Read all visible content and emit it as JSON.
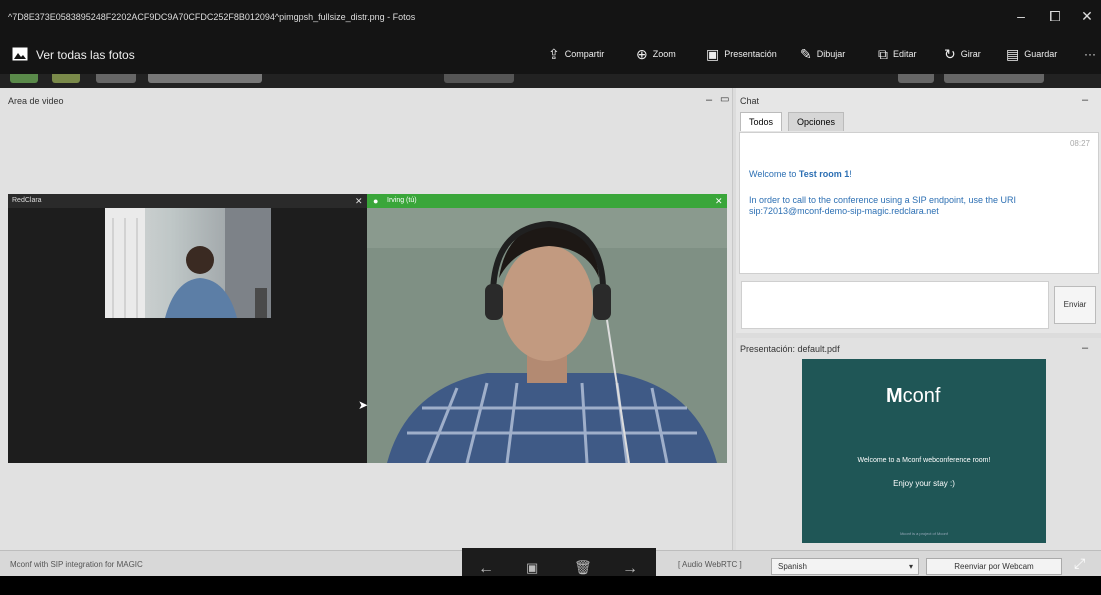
{
  "window": {
    "title": "^7D8E373E0583895248F2202ACF9DC9A70CFDC252F8B012094^pimgpsh_fullsize_distr.png - Fotos",
    "minimize": "‒",
    "maximize": "⧠",
    "close": "✕"
  },
  "toolbar": {
    "back_label": "Ver todas las fotos",
    "items": [
      {
        "label": "Compartir",
        "icon": "share-icon"
      },
      {
        "label": "Zoom",
        "icon": "zoom-icon"
      },
      {
        "label": "Presentación",
        "icon": "slideshow-icon"
      },
      {
        "label": "Dibujar",
        "icon": "draw-icon"
      },
      {
        "label": "Editar",
        "icon": "edit-icon"
      },
      {
        "label": "Girar",
        "icon": "rotate-icon"
      },
      {
        "label": "Guardar",
        "icon": "save-icon"
      }
    ],
    "more": "···"
  },
  "video": {
    "panel_title": "Area de video",
    "minimize": "–",
    "maximize": "▭",
    "feed1_name": "RedClara",
    "feed1_close": "✕",
    "feed2_name": "Irving (tú)",
    "feed2_close": "✕"
  },
  "chat": {
    "panel_title": "Chat",
    "minimize": "–",
    "tabs": [
      "Todos",
      "Opciones"
    ],
    "time": "08:27",
    "welcome_prefix": "Welcome to ",
    "room": "Test room 1",
    "welcome_suffix": "!",
    "sip_msg": "In order to call to the conference using a SIP endpoint, use the URI sip:72013@mconf-demo-sip-magic.redclara.net",
    "send_label": "Enviar"
  },
  "presentation": {
    "panel_title": "Presentación: default.pdf",
    "minimize": "–",
    "logo_m": "M",
    "logo_rest": "conf",
    "welcome": "Welcome to a Mconf webconference room!",
    "enjoy": "Enjoy your stay :)",
    "footer": "Mconf is a project of Mconf"
  },
  "status": {
    "left_text": "Mconf with SIP integration for MAGIC",
    "audio": "[ Audio WebRTC ]",
    "language": "Spanish",
    "webcam_btn": "Reenviar por Webcam"
  },
  "nav": {
    "prev": "←",
    "next": "→"
  }
}
